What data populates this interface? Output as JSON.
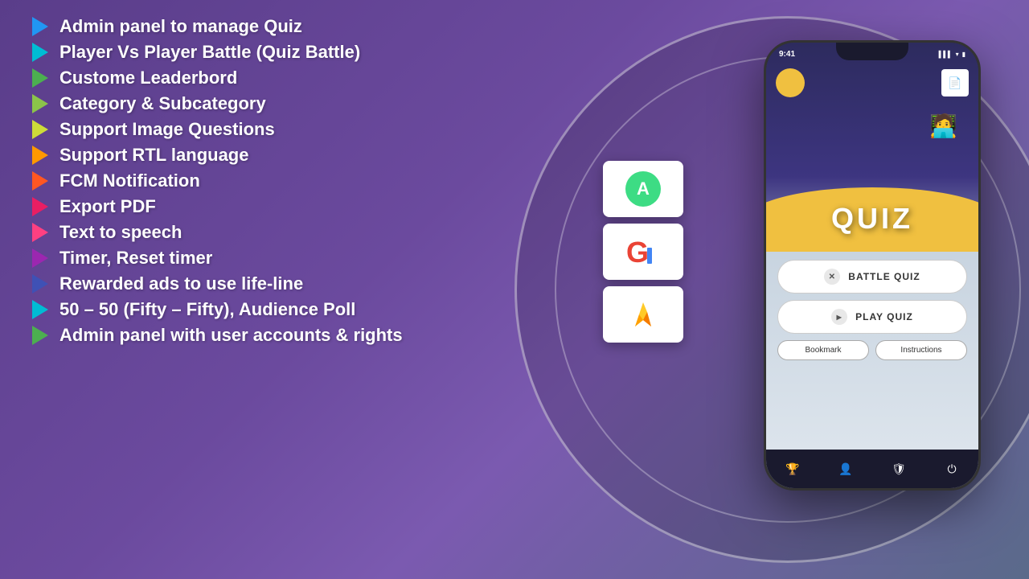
{
  "background": {
    "gradient_start": "#5a3d8a",
    "gradient_end": "#5a6a8a"
  },
  "feature_list": {
    "items": [
      {
        "id": 1,
        "text": "Admin panel to manage Quiz",
        "color": "#2196F3"
      },
      {
        "id": 2,
        "text": "Player Vs Player Battle (Quiz Battle)",
        "color": "#00BCD4"
      },
      {
        "id": 3,
        "text": "Custome Leaderbord",
        "color": "#4CAF50"
      },
      {
        "id": 4,
        "text": "Category & Subcategory",
        "color": "#8BC34A"
      },
      {
        "id": 5,
        "text": "Support Image Questions",
        "color": "#CDDC39"
      },
      {
        "id": 6,
        "text": "Support RTL language",
        "color": "#FF9800"
      },
      {
        "id": 7,
        "text": "FCM Notification",
        "color": "#FF5722"
      },
      {
        "id": 8,
        "text": "Export PDF",
        "color": "#E91E63"
      },
      {
        "id": 9,
        "text": "Text to speech",
        "color": "#FF4081"
      },
      {
        "id": 10,
        "text": "Timer, Reset timer",
        "color": "#9C27B0"
      },
      {
        "id": 11,
        "text": "Rewarded ads to use life-line",
        "color": "#3F51B5"
      },
      {
        "id": 12,
        "text": "50 – 50 (Fifty – Fifty), Audience Poll",
        "color": "#00BCD4"
      },
      {
        "id": 13,
        "text": "Admin panel with user accounts & rights",
        "color": "#4CAF50"
      }
    ]
  },
  "tech_logos": [
    {
      "id": "android",
      "color": "#3DDC84",
      "label": "Android"
    },
    {
      "id": "google",
      "color": "#EA4335",
      "label": "Google"
    },
    {
      "id": "firebase",
      "color": "#FFCA28",
      "label": "Firebase"
    }
  ],
  "phone": {
    "status_time": "9:41",
    "quiz_title": "QUIZ",
    "battle_btn_label": "BATTLE QUIZ",
    "play_btn_label": "PLAY QUIZ",
    "bookmark_label": "Bookmark",
    "instructions_label": "Instructions",
    "nav_icons": [
      "🏆",
      "👤",
      "🛡",
      "⏻"
    ]
  }
}
